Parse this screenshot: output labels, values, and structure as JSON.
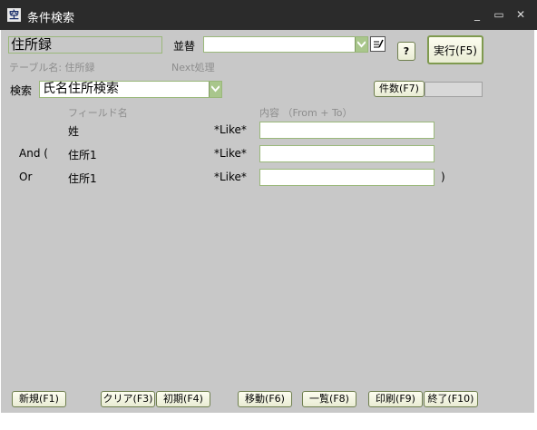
{
  "window": {
    "title": "条件検索",
    "minimize_glyph": "_",
    "maximize_glyph": "▭",
    "close_glyph": "✕"
  },
  "header": {
    "table_name_value": "住所録",
    "sort_label": "並替",
    "sort_value": "",
    "help_glyph": "?",
    "execute_label": "実行(F5)",
    "table_name_caption": "テーブル名: 住所録",
    "next_process_caption": "Next処理"
  },
  "search": {
    "label": "検索",
    "selected": "氏名住所検索",
    "count_button": "件数(F7)",
    "count_value": ""
  },
  "criteria": {
    "field_header": "フィールド名",
    "content_header": "内容 （From + To）",
    "rows": [
      {
        "conj": "",
        "field": "姓",
        "op": "*Like*",
        "value": "",
        "close": ""
      },
      {
        "conj": "And (",
        "field": "住所1",
        "op": "*Like*",
        "value": "",
        "close": ""
      },
      {
        "conj": "Or",
        "field": "住所1",
        "op": "*Like*",
        "value": "",
        "close": ")"
      }
    ]
  },
  "footer": {
    "new": "新規(F1)",
    "clear": "クリア(F3)",
    "init": "初期(F4)",
    "move": "移動(F6)",
    "list": "一覧(F8)",
    "print": "印刷(F9)",
    "exit": "終了(F10)"
  },
  "colors": {
    "titlebar": "#2b2b2b",
    "client": "#c8c8c8",
    "field_border": "#9ab87a",
    "combo_arrow": "#a9c68c"
  }
}
